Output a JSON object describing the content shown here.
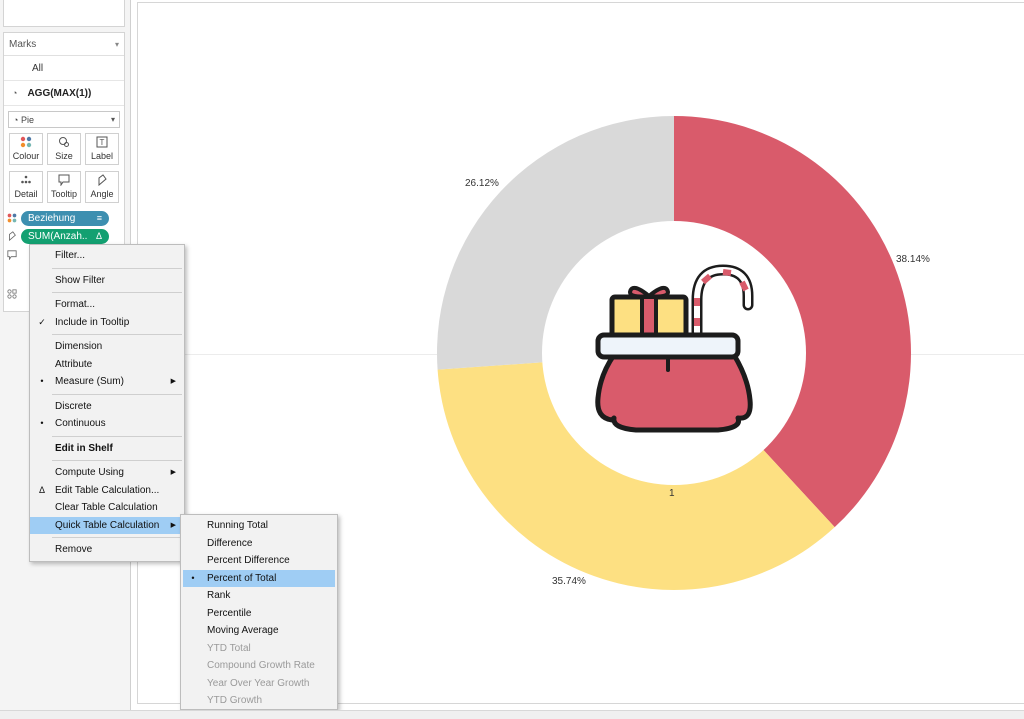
{
  "sidebar": {
    "marks_title": "Marks",
    "all_label": "All",
    "agg_label": "AGG(MAX(1))",
    "mark_type": "Pie",
    "buttons": [
      {
        "label": "Colour",
        "icon": "colour-dots-icon"
      },
      {
        "label": "Size",
        "icon": "size-icon"
      },
      {
        "label": "Label",
        "icon": "label-icon"
      },
      {
        "label": "Detail",
        "icon": "detail-dots-icon"
      },
      {
        "label": "Tooltip",
        "icon": "tooltip-icon"
      },
      {
        "label": "Angle",
        "icon": "angle-icon"
      }
    ],
    "pills": [
      {
        "label": "Beziehung",
        "suffix": "≡",
        "color": "#3d8fb0",
        "icon": "colour-dots-icon"
      },
      {
        "label": "SUM(Anzah..",
        "suffix": "Δ",
        "color": "#13a071",
        "icon": "angle-icon"
      }
    ]
  },
  "chart_data": {
    "type": "pie",
    "donut": true,
    "slices": [
      {
        "label": "38.14%",
        "value": 38.14,
        "color": "#d95b6b"
      },
      {
        "label": "35.74%",
        "value": 35.74,
        "color": "#fde082"
      },
      {
        "label": "26.12%",
        "value": 26.12,
        "color": "#d9d9d9"
      }
    ],
    "center_label": "1",
    "start": "top",
    "direction": "clockwise"
  },
  "center_icon": "santa-sack-with-gift-and-candy-cane-icon",
  "context_menu": {
    "items": [
      {
        "label": "Filter...",
        "type": "item"
      },
      {
        "type": "sep"
      },
      {
        "label": "Show Filter",
        "type": "item"
      },
      {
        "type": "sep"
      },
      {
        "label": "Format...",
        "type": "item"
      },
      {
        "label": "Include in Tooltip",
        "type": "item",
        "mark": "✓"
      },
      {
        "type": "sep"
      },
      {
        "label": "Dimension",
        "type": "item"
      },
      {
        "label": "Attribute",
        "type": "item"
      },
      {
        "label": "Measure (Sum)",
        "type": "item",
        "mark": "•",
        "submenu": true
      },
      {
        "type": "sep"
      },
      {
        "label": "Discrete",
        "type": "item"
      },
      {
        "label": "Continuous",
        "type": "item",
        "mark": "•"
      },
      {
        "type": "sep"
      },
      {
        "label": "Edit in Shelf",
        "type": "item",
        "bold": true
      },
      {
        "type": "sep"
      },
      {
        "label": "Compute Using",
        "type": "item",
        "submenu": true
      },
      {
        "label": "Edit Table Calculation...",
        "type": "item",
        "mark": "Δ"
      },
      {
        "label": "Clear Table Calculation",
        "type": "item"
      },
      {
        "label": "Quick Table Calculation",
        "type": "item",
        "submenu": true,
        "highlight": true
      },
      {
        "type": "sep"
      },
      {
        "label": "Remove",
        "type": "item"
      }
    ]
  },
  "submenu": {
    "items": [
      {
        "label": "Running Total"
      },
      {
        "label": "Difference"
      },
      {
        "label": "Percent Difference"
      },
      {
        "label": "Percent of Total",
        "mark": "•",
        "highlight": true
      },
      {
        "label": "Rank"
      },
      {
        "label": "Percentile"
      },
      {
        "label": "Moving Average"
      },
      {
        "label": "YTD Total",
        "disabled": true
      },
      {
        "label": "Compound Growth Rate",
        "disabled": true
      },
      {
        "label": "Year Over Year Growth",
        "disabled": true
      },
      {
        "label": "YTD Growth",
        "disabled": true
      }
    ]
  }
}
